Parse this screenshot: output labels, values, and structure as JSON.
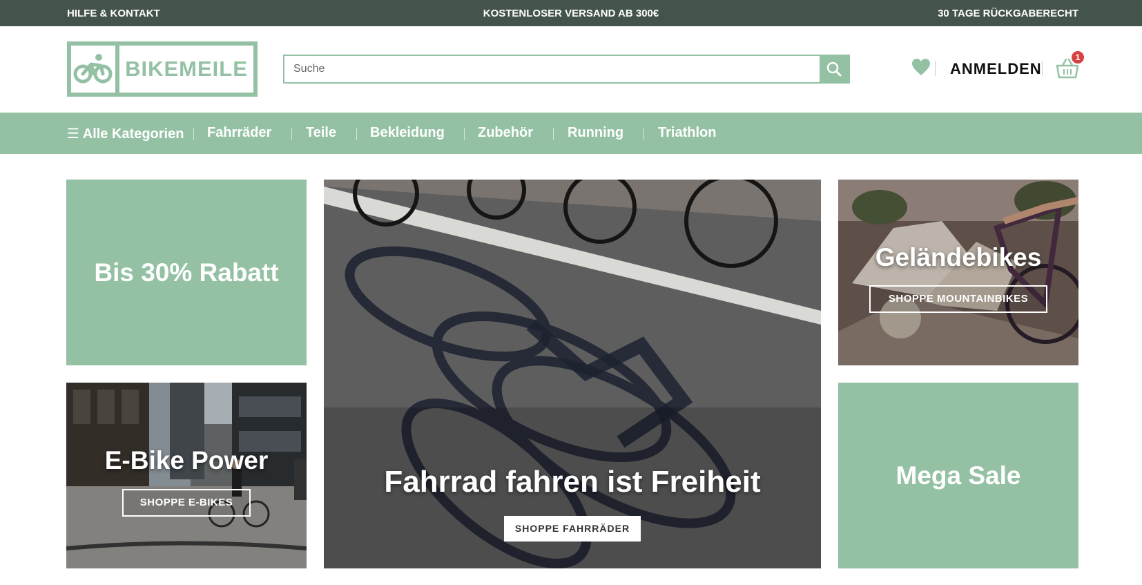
{
  "topbar": {
    "left": "HILFE & KONTAKT",
    "center": "KOSTENLOSER VERSAND AB 300€",
    "right": "30 TAGE RÜCKGABERECHT"
  },
  "header": {
    "logo_text": "BIKEMEILE",
    "search_placeholder": "Suche",
    "login_label": "ANMELDEN",
    "cart_count": "1",
    "icons": [
      "bike-logo-icon",
      "search-icon",
      "heart-icon",
      "basket-icon"
    ]
  },
  "nav": {
    "all_categories": "☰ Alle Kategorien",
    "items": [
      "Fahrräder",
      "Teile",
      "Bekleidung",
      "Zubehör",
      "Running",
      "Triathlon"
    ]
  },
  "tiles": {
    "rabatt": {
      "title": "Bis 30% Rabatt"
    },
    "ebike": {
      "title": "E-Bike Power",
      "button": "SHOPPE E-BIKES"
    },
    "hero": {
      "title": "Fahrrad fahren ist Freiheit",
      "button": "SHOPPE FAHRRÄDER"
    },
    "gelaende": {
      "title": "Geländebikes",
      "button": "SHOPPE MOUNTAINBIKES"
    },
    "mega": {
      "title": "Mega Sale"
    }
  },
  "colors": {
    "brand_green": "#94c1a4",
    "topbar_dark": "#44544b",
    "badge_red": "#d84242"
  }
}
